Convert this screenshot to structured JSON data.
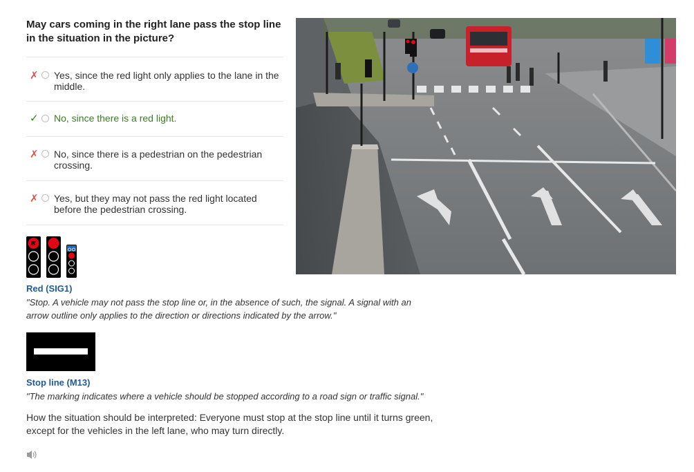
{
  "question": {
    "line1": "May cars coming in the right lane pass the stop line",
    "line2": "in the situation in the picture?"
  },
  "answers": [
    {
      "mark": "✗",
      "label_line1": "Yes, since the red light only applies to the lane in the",
      "label_line2": "middle.",
      "status": "wrong"
    },
    {
      "mark": "✓",
      "label_line1": "No, since there is a red light.",
      "label_line2": "",
      "status": "correct"
    },
    {
      "mark": "✗",
      "label_line1": "No, since there is a pedestrian on the pedestrian",
      "label_line2": "crossing.",
      "status": "wrong"
    },
    {
      "mark": "✗",
      "label_line1": "Yes, but they may not pass the red light located",
      "label_line2": "before the pedestrian crossing.",
      "status": "wrong"
    }
  ],
  "sig1": {
    "title": "Red (SIG1)",
    "quote_line1": "\"Stop. A vehicle may not pass the stop line or, in the absence of such, the signal. A signal with an",
    "quote_line2": "arrow outline only applies to the direction or directions indicated by the arrow.\""
  },
  "m13": {
    "title": "Stop line (M13)",
    "quote": "\"The marking indicates where a vehicle should be stopped according to a road sign or traffic signal.\""
  },
  "interpretation": {
    "line1": "How the situation should be interpreted: Everyone must stop at the stop line until it turns green,",
    "line2": "except for the vehicles in the left lane, who may turn directly."
  },
  "icons": {
    "speaker": "speaker-icon",
    "wrong": "cross-icon",
    "correct": "check-icon"
  },
  "colors": {
    "wrong": "#d9534f",
    "correct": "#3a7d21",
    "link": "#1f5a96",
    "signal_red": "#e30613"
  }
}
